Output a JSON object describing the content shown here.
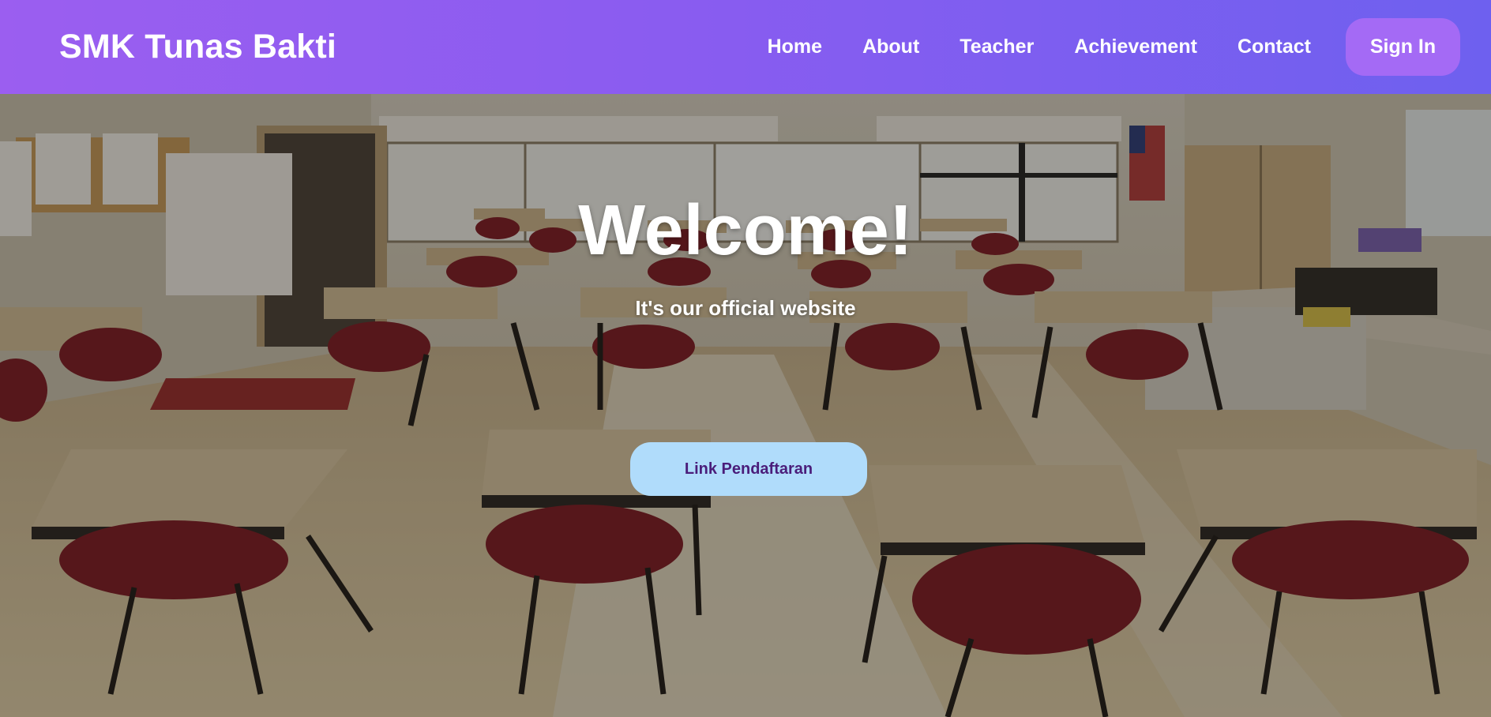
{
  "navbar": {
    "brand": "SMK Tunas Bakti",
    "links": [
      "Home",
      "About",
      "Teacher",
      "Achievement",
      "Contact"
    ],
    "signin_label": "Sign In"
  },
  "hero": {
    "title": "Welcome!",
    "subtitle": "It's our official website",
    "cta_label": "Link Pendaftaran",
    "background_image": "classroom-photo"
  },
  "colors": {
    "navbar_gradient_start": "#9b5ef0",
    "navbar_gradient_end": "#6e60ef",
    "signin_bg": "#a46af5",
    "cta_bg": "#b0dcfb",
    "cta_text": "#4a1d7a"
  }
}
